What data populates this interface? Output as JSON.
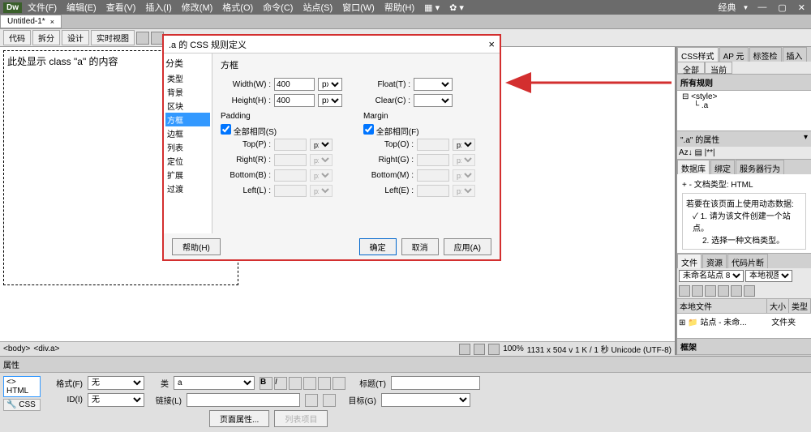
{
  "titlebar": {
    "logo": "Dw",
    "menus": [
      "文件(F)",
      "编辑(E)",
      "查看(V)",
      "插入(I)",
      "修改(M)",
      "格式(O)",
      "命令(C)",
      "站点(S)",
      "窗口(W)",
      "帮助(H)"
    ],
    "workspace_label": "经典"
  },
  "doc_tab": {
    "name": "Untitled-1*",
    "close": "×"
  },
  "toolbar": {
    "buttons": [
      "代码",
      "拆分",
      "设计",
      "实时视图"
    ]
  },
  "canvas": {
    "text": "此处显示 class \"a\" 的内容"
  },
  "dialog": {
    "title": ".a 的 CSS 规则定义",
    "close": "×",
    "sidebar_title": "分类",
    "sidebar_items": [
      "类型",
      "背景",
      "区块",
      "方框",
      "边框",
      "列表",
      "定位",
      "扩展",
      "过渡"
    ],
    "section_title": "方框",
    "width_label": "Width(W) :",
    "width_value": "400",
    "width_unit": "px",
    "height_label": "Height(H) :",
    "height_value": "400",
    "height_unit": "px",
    "float_label": "Float(T) :",
    "clear_label": "Clear(C) :",
    "padding_title": "Padding",
    "margin_title": "Margin",
    "same_all_s": "全部相同(S)",
    "same_all_f": "全部相同(F)",
    "top_p": "Top(P) :",
    "right_r": "Right(R) :",
    "bottom_b": "Bottom(B) :",
    "left_l": "Left(L) :",
    "top_o": "Top(O) :",
    "right_g": "Right(G) :",
    "bottom_m": "Bottom(M) :",
    "left_e": "Left(E) :",
    "unit_px": "px",
    "help": "帮助(H)",
    "ok": "确定",
    "cancel": "取消",
    "apply": "应用(A)"
  },
  "right": {
    "css_tabs": [
      "CSS样式",
      "AP 元",
      "标签检",
      "插入"
    ],
    "subtabs": [
      "全部",
      "当前"
    ],
    "rules_title": "所有规则",
    "rules_tree_root": "<style>",
    "rules_tree_child": ".a",
    "attr_title": "\".a\" 的属性",
    "attr_tools": "Az↓",
    "db_tabs": [
      "数据库",
      "绑定",
      "服务器行为"
    ],
    "db_doc_type": "文档类型: HTML",
    "db_notice": "若要在该页面上使用动态数据:",
    "db_step1": "1. 请为该文件创建一个站点。",
    "db_step2": "2. 选择一种文档类型。",
    "files_tabs": [
      "文件",
      "资源",
      "代码片断"
    ],
    "site_name": "未命名站点 8",
    "view_label": "本地视图",
    "files_cols": [
      "本地文件",
      "大小",
      "类型"
    ],
    "files_row": "站点 - 未命...",
    "files_type": "文件夹",
    "frame_title": "框架"
  },
  "status": {
    "breadcrumb": [
      "<body>",
      "<div.a>"
    ],
    "zoom": "100%",
    "dims": "1131 x 504 v 1 K / 1 秒 Unicode (UTF-8)"
  },
  "props": {
    "panel_title": "属性",
    "html_btn": "HTML",
    "css_btn": "CSS",
    "format_label": "格式(F)",
    "format_value": "无",
    "id_label": "ID(I)",
    "id_value": "无",
    "class_label": "类",
    "class_value": "a",
    "link_label": "链接(L)",
    "title_label": "标题(T)",
    "target_label": "目标(G)",
    "page_props": "页面属性...",
    "list_item": "列表项目"
  }
}
